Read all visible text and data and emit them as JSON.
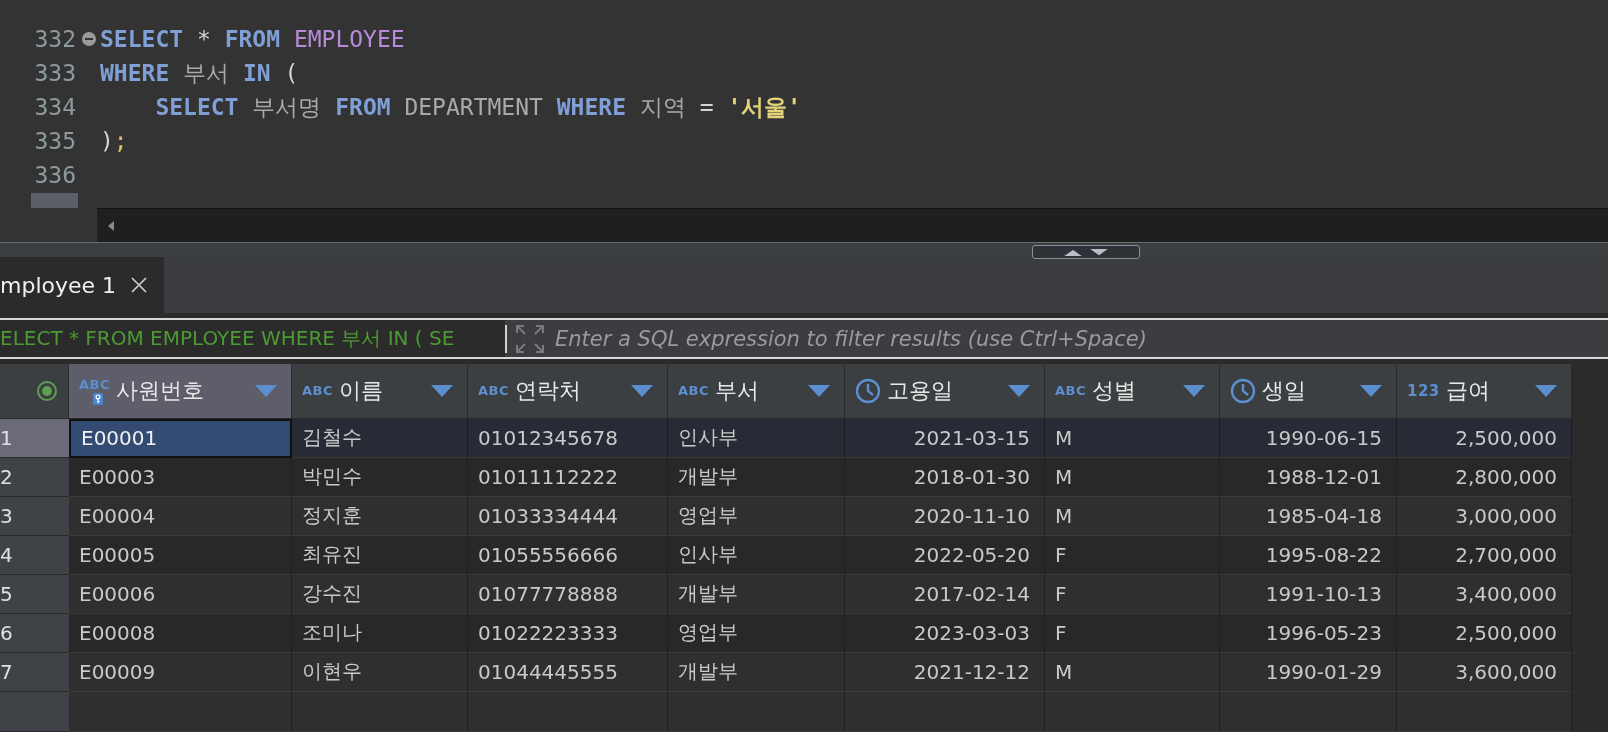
{
  "editor": {
    "lines": [
      {
        "number": "332",
        "foldable": true,
        "tokens": [
          {
            "kind": "keyword",
            "text": "SELECT"
          },
          {
            "kind": "operator",
            "text": " * "
          },
          {
            "kind": "keyword",
            "text": "FROM"
          },
          {
            "kind": "table",
            "text": " EMPLOYEE"
          }
        ]
      },
      {
        "number": "333",
        "foldable": false,
        "tokens": [
          {
            "kind": "keyword",
            "text": "WHERE"
          },
          {
            "kind": "ident",
            "text": " 부서 "
          },
          {
            "kind": "keyword",
            "text": "IN"
          },
          {
            "kind": "operator",
            "text": " ("
          }
        ]
      },
      {
        "number": "334",
        "foldable": false,
        "tokens": [
          {
            "kind": "keyword",
            "text": "    SELECT"
          },
          {
            "kind": "ident",
            "text": " 부서명 "
          },
          {
            "kind": "keyword",
            "text": "FROM"
          },
          {
            "kind": "ident",
            "text": " DEPARTMENT "
          },
          {
            "kind": "keyword",
            "text": "WHERE"
          },
          {
            "kind": "ident",
            "text": " 지역 "
          },
          {
            "kind": "operator",
            "text": "= "
          },
          {
            "kind": "string",
            "text": "'서울'"
          }
        ]
      },
      {
        "number": "335",
        "foldable": false,
        "tokens": [
          {
            "kind": "operator",
            "text": ")"
          },
          {
            "kind": "semicolon",
            "text": ";"
          }
        ]
      },
      {
        "number": "336",
        "foldable": false
      }
    ]
  },
  "results_tabs": [
    {
      "label": "mployee 1",
      "selected": true
    }
  ],
  "filter": {
    "query": "ELECT * FROM EMPLOYEE WHERE 부서 IN ( SE",
    "placeholder": "Enter a SQL expression to filter results (use Ctrl+Space)"
  },
  "table": {
    "columns": [
      {
        "label": "사원번호",
        "kind": "text",
        "type_badge": "ABC",
        "primary_key": true,
        "selected": true
      },
      {
        "label": "이름",
        "kind": "text",
        "type_badge": "ABC",
        "primary_key": false,
        "selected": false
      },
      {
        "label": "연락처",
        "kind": "text",
        "type_badge": "ABC",
        "primary_key": false,
        "selected": false
      },
      {
        "label": "부서",
        "kind": "text",
        "type_badge": "ABC",
        "primary_key": false,
        "selected": false
      },
      {
        "label": "고용일",
        "kind": "datetime",
        "primary_key": false,
        "selected": false
      },
      {
        "label": "성별",
        "kind": "text",
        "type_badge": "ABC",
        "primary_key": false,
        "selected": false
      },
      {
        "label": "생일",
        "kind": "datetime",
        "primary_key": false,
        "selected": false
      },
      {
        "label": "급여",
        "kind": "number",
        "type_badge": "123",
        "primary_key": false,
        "selected": false
      }
    ],
    "rows": [
      {
        "number": "1",
        "selected": true,
        "cells": [
          {
            "text": "E00001",
            "selected": true
          },
          {
            "text": "김철수",
            "selected": false
          },
          {
            "text": "01012345678",
            "selected": false
          },
          {
            "text": "인사부",
            "selected": false
          },
          {
            "text": "2021-03-15",
            "selected": false
          },
          {
            "text": "M",
            "selected": false
          },
          {
            "text": "1990-06-15",
            "selected": false
          },
          {
            "text": "2,500,000",
            "selected": false
          }
        ]
      },
      {
        "number": "2",
        "selected": false,
        "cells": [
          {
            "text": "E00003",
            "selected": false
          },
          {
            "text": "박민수",
            "selected": false
          },
          {
            "text": "01011112222",
            "selected": false
          },
          {
            "text": "개발부",
            "selected": false
          },
          {
            "text": "2018-01-30",
            "selected": false
          },
          {
            "text": "M",
            "selected": false
          },
          {
            "text": "1988-12-01",
            "selected": false
          },
          {
            "text": "2,800,000",
            "selected": false
          }
        ]
      },
      {
        "number": "3",
        "selected": false,
        "cells": [
          {
            "text": "E00004",
            "selected": false
          },
          {
            "text": "정지훈",
            "selected": false
          },
          {
            "text": "01033334444",
            "selected": false
          },
          {
            "text": "영업부",
            "selected": false
          },
          {
            "text": "2020-11-10",
            "selected": false
          },
          {
            "text": "M",
            "selected": false
          },
          {
            "text": "1985-04-18",
            "selected": false
          },
          {
            "text": "3,000,000",
            "selected": false
          }
        ]
      },
      {
        "number": "4",
        "selected": false,
        "cells": [
          {
            "text": "E00005",
            "selected": false
          },
          {
            "text": "최유진",
            "selected": false
          },
          {
            "text": "01055556666",
            "selected": false
          },
          {
            "text": "인사부",
            "selected": false
          },
          {
            "text": "2022-05-20",
            "selected": false
          },
          {
            "text": "F",
            "selected": false
          },
          {
            "text": "1995-08-22",
            "selected": false
          },
          {
            "text": "2,700,000",
            "selected": false
          }
        ]
      },
      {
        "number": "5",
        "selected": false,
        "cells": [
          {
            "text": "E00006",
            "selected": false
          },
          {
            "text": "강수진",
            "selected": false
          },
          {
            "text": "01077778888",
            "selected": false
          },
          {
            "text": "개발부",
            "selected": false
          },
          {
            "text": "2017-02-14",
            "selected": false
          },
          {
            "text": "F",
            "selected": false
          },
          {
            "text": "1991-10-13",
            "selected": false
          },
          {
            "text": "3,400,000",
            "selected": false
          }
        ]
      },
      {
        "number": "6",
        "selected": false,
        "cells": [
          {
            "text": "E00008",
            "selected": false
          },
          {
            "text": "조미나",
            "selected": false
          },
          {
            "text": "01022223333",
            "selected": false
          },
          {
            "text": "영업부",
            "selected": false
          },
          {
            "text": "2023-03-03",
            "selected": false
          },
          {
            "text": "F",
            "selected": false
          },
          {
            "text": "1996-05-23",
            "selected": false
          },
          {
            "text": "2,500,000",
            "selected": false
          }
        ]
      },
      {
        "number": "7",
        "selected": false,
        "cells": [
          {
            "text": "E00009",
            "selected": false
          },
          {
            "text": "이현우",
            "selected": false
          },
          {
            "text": "01044445555",
            "selected": false
          },
          {
            "text": "개발부",
            "selected": false
          },
          {
            "text": "2021-12-12",
            "selected": false
          },
          {
            "text": "M",
            "selected": false
          },
          {
            "text": "1990-01-29",
            "selected": false
          },
          {
            "text": "3,600,000",
            "selected": false
          }
        ]
      }
    ]
  }
}
